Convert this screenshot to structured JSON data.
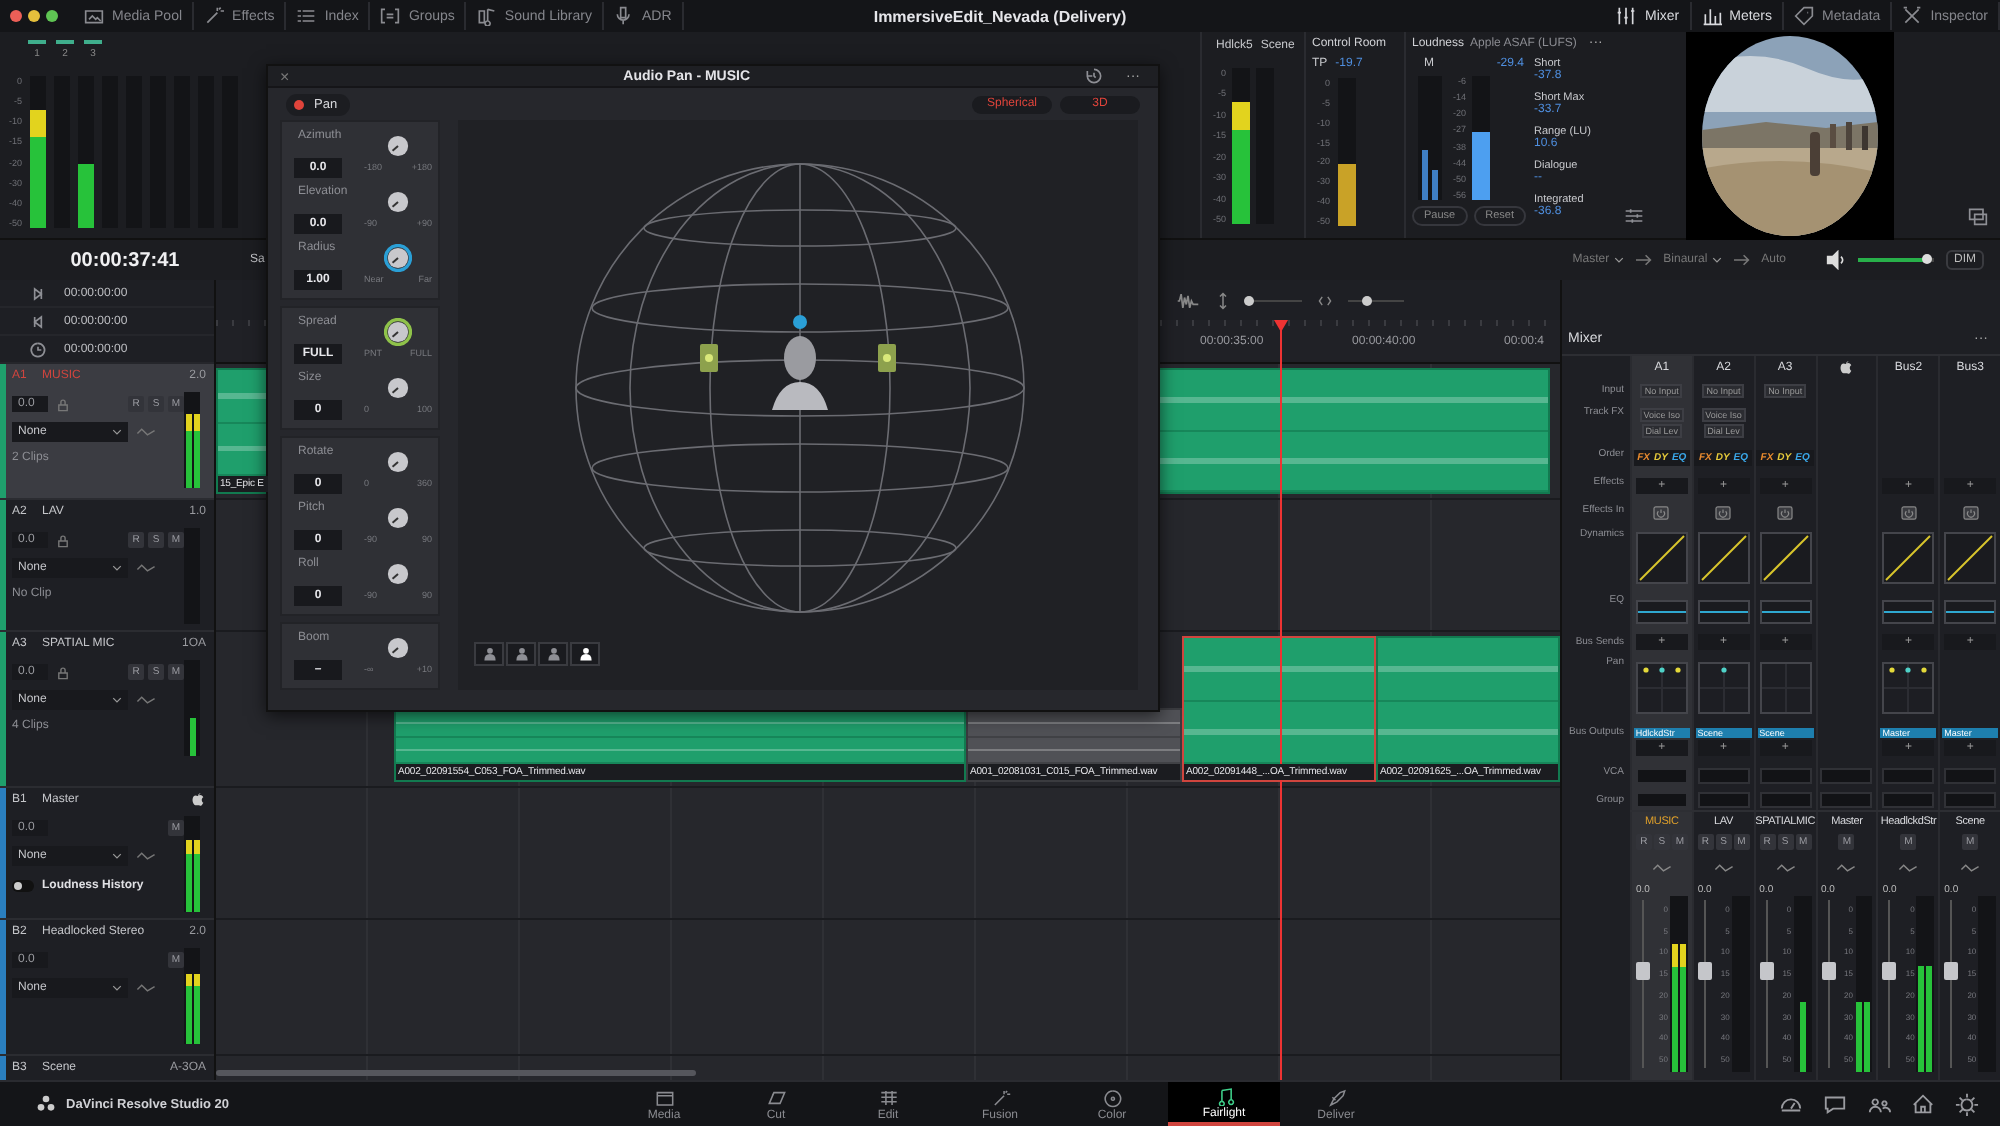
{
  "top_bar": {
    "tabs": [
      {
        "label": "Media Pool"
      },
      {
        "label": "Effects"
      },
      {
        "label": "Index"
      },
      {
        "label": "Groups"
      },
      {
        "label": "Sound Library"
      },
      {
        "label": "ADR"
      }
    ],
    "title": "ImmersiveEdit_Nevada (Delivery)",
    "panels": [
      {
        "label": "Mixer",
        "selected": true
      },
      {
        "label": "Meters",
        "selected": true
      },
      {
        "label": "Metadata",
        "selected": false
      },
      {
        "label": "Inspector",
        "selected": false
      }
    ]
  },
  "meter_panel": {
    "channels": [
      "1",
      "2",
      "3"
    ],
    "scale": [
      "0",
      "-5",
      "-10",
      "-15",
      "-20",
      "-30",
      "-40",
      "-50"
    ],
    "meters": [
      {
        "level": 0.78
      },
      {
        "level": 0
      },
      {
        "level": 0.42
      },
      {
        "level": 0
      },
      {
        "level": 0
      },
      {
        "level": 0
      },
      {
        "level": 0
      },
      {
        "level": 0
      },
      {
        "level": 0
      }
    ]
  },
  "hdlck": {
    "labels": [
      "Hdlck5",
      "Scene"
    ],
    "scale": [
      "0",
      "-5",
      "-10",
      "-15",
      "-20",
      "-30",
      "-40",
      "-50"
    ],
    "meters": [
      {
        "level": 0.78
      },
      {
        "level": 0
      }
    ]
  },
  "control_room": {
    "title": "Control Room",
    "tp_label": "TP",
    "tp_value": "-19.7",
    "scale": [
      "0",
      "-5",
      "-10",
      "-15",
      "-20",
      "-30",
      "-40",
      "-50"
    ],
    "meter": {
      "level": 0.42,
      "color": "#c9a227"
    }
  },
  "loudness": {
    "title": "Loudness",
    "standard": "Apple ASAF (LUFS)",
    "more": "···",
    "m_label": "M",
    "m_value": "-29.4",
    "scale": [
      "-6",
      "-14",
      "-20",
      "-27",
      "-38",
      "-44",
      "-50",
      "-56"
    ],
    "m_meters": [
      {
        "level": 0.4,
        "color": "#3f7fc4"
      },
      {
        "level": 0.25,
        "color": "#3f7fc4"
      }
    ],
    "right_meter": {
      "level": 0.55,
      "color": "#4d9ff0"
    },
    "stats": [
      {
        "label": "Short",
        "value": "-37.8"
      },
      {
        "label": "Short Max",
        "value": "-33.7"
      },
      {
        "label": "Range (LU)",
        "value": "10.6"
      },
      {
        "label": "Dialogue",
        "value": "--"
      },
      {
        "label": "Integrated",
        "value": "-36.8"
      }
    ],
    "buttons": [
      "Pause",
      "Reset"
    ]
  },
  "transport": {
    "timecode": "00:00:37:41",
    "cut_text": "Sa",
    "marks": [
      "00:00:00:00",
      "00:00:00:00",
      "00:00:00:00"
    ]
  },
  "monitor_route": {
    "source": "Master",
    "format": "Binaural",
    "mode": "Auto",
    "volume": {
      "level": 0.92
    },
    "dim": "DIM"
  },
  "pan_window": {
    "title": "Audio Pan - MUSIC",
    "close": "×",
    "more": "···",
    "pan": {
      "label": "Pan",
      "on": true
    },
    "modes": [
      {
        "label": "Spherical",
        "selected": true
      },
      {
        "label": "3D",
        "selected": true
      }
    ],
    "groups": [
      {
        "knobs": [
          {
            "label": "Azimuth",
            "value": "0.0",
            "min": "-180",
            "max": "+180"
          },
          {
            "label": "Elevation",
            "value": "0.0",
            "min": "-90",
            "max": "+90"
          },
          {
            "label": "Radius",
            "value": "1.00",
            "min": "Near",
            "max": "Far",
            "color": "#2a9fd6"
          }
        ]
      },
      {
        "knobs": [
          {
            "label": "Spread",
            "value": "FULL",
            "min": "PNT",
            "max": "FULL",
            "color": "#8fc24a"
          },
          {
            "label": "Size",
            "value": "0",
            "min": "0",
            "max": "100"
          }
        ]
      },
      {
        "knobs": [
          {
            "label": "Rotate",
            "value": "0",
            "min": "0",
            "max": "360"
          },
          {
            "label": "Pitch",
            "value": "0",
            "min": "-90",
            "max": "90"
          },
          {
            "label": "Roll",
            "value": "0",
            "min": "-90",
            "max": "90"
          }
        ]
      },
      {
        "knobs": [
          {
            "label": "Boom",
            "value": "–",
            "min": "-∞",
            "max": "+10"
          }
        ]
      }
    ],
    "views": [
      {
        "selected": false
      },
      {
        "selected": false
      },
      {
        "selected": false
      },
      {
        "selected": true
      }
    ]
  },
  "tracks": [
    {
      "id": "A1",
      "name": "MUSIC",
      "format": "2.0",
      "color": "#1f9f6c",
      "selected": true,
      "kind": "audio",
      "volume": "0.0",
      "buttons": [
        "R",
        "S",
        "M"
      ],
      "input": "None",
      "info": "2 Clips",
      "meters": [
        {
          "level": 0.78
        },
        {
          "level": 0.78
        }
      ],
      "clips": [
        {
          "label": "15_Epic E",
          "selected": false,
          "muted": false
        },
        {
          "selected": false,
          "muted": false
        }
      ]
    },
    {
      "id": "A2",
      "name": "LAV",
      "format": "1.0",
      "color": "#1f9f6c",
      "selected": false,
      "kind": "audio",
      "volume": "0.0",
      "buttons": [
        "R",
        "S",
        "M"
      ],
      "input": "None",
      "info": "No Clip",
      "meters": [
        {
          "level": 0
        }
      ]
    },
    {
      "id": "A3",
      "name": "SPATIAL MIC",
      "format": "1OA",
      "color": "#1f9f6c",
      "selected": false,
      "kind": "audio",
      "volume": "0.0",
      "buttons": [
        "R",
        "S",
        "M"
      ],
      "input": "None",
      "info": "4 Clips",
      "meters": [
        {
          "level": 0.4
        }
      ],
      "clips": [
        {
          "label": "A002_02091554_C053_FOA_Trimmed.wav",
          "selected": false,
          "muted": false
        },
        {
          "label": "A001_02081031_C015_FOA_Trimmed.wav",
          "selected": false,
          "muted": true
        },
        {
          "label": "A002_02091448_...OA_Trimmed.wav",
          "selected": true,
          "muted": false
        },
        {
          "label": "A002_02091625_...OA_Trimmed.wav",
          "selected": false,
          "muted": false
        }
      ]
    },
    {
      "id": "B1",
      "name": "Master",
      "color": "#2a7fbf",
      "selected": false,
      "kind": "master",
      "volume": "0.0",
      "buttons": [
        "M"
      ],
      "input": "None",
      "toggle": {
        "label": "Loudness History",
        "on": false
      },
      "meters": [
        {
          "level": 0.75
        },
        {
          "level": 0.75
        }
      ]
    },
    {
      "id": "B2",
      "name": "Headlocked Stereo",
      "format": "2.0",
      "color": "#2a7fbf",
      "selected": false,
      "kind": "bus",
      "volume": "0.0",
      "buttons": [
        "M"
      ],
      "input": "None",
      "meters": [
        {
          "level": 0.73
        },
        {
          "level": 0.73
        }
      ]
    },
    {
      "id": "B3",
      "name": "Scene",
      "format": "A-3OA",
      "color": "#2a7fbf",
      "selected": false,
      "kind": "bus"
    }
  ],
  "timeline": {
    "ruler": [
      "00:00:35:00",
      "00:00:40:00",
      "00:00:4"
    ],
    "zoom": [
      {
        "level": 0.05
      },
      {
        "level": 0.35
      }
    ]
  },
  "mixer": {
    "title": "Mixer",
    "more": "···",
    "row_labels": [
      "Input",
      "Track FX",
      "Order",
      "Effects",
      "Effects In",
      "Dynamics",
      "EQ",
      "Bus Sends",
      "Pan",
      "Bus Outputs",
      "VCA",
      "Group"
    ],
    "columns": [
      {
        "label": "A1",
        "kind": "track",
        "selected": true,
        "input": "No Input",
        "fx": [
          "Voice Iso",
          "Dial Lev"
        ],
        "order": [
          "FX",
          "DY",
          "EQ"
        ],
        "effects": "+",
        "sends": "+",
        "pan": {
          "kind": "multi"
        },
        "output": "HdlckdStr",
        "output_add": "+"
      },
      {
        "label": "A2",
        "kind": "track",
        "selected": false,
        "input": "No Input",
        "fx": [
          "Voice Iso",
          "Dial Lev"
        ],
        "order": [
          "FX",
          "DY",
          "EQ"
        ],
        "effects": "+",
        "sends": "+",
        "pan": {
          "kind": "single"
        },
        "output": "Scene",
        "output_add": "+"
      },
      {
        "label": "A3",
        "kind": "track",
        "selected": false,
        "input": "No Input",
        "order": [
          "FX",
          "DY",
          "EQ"
        ],
        "effects": "+",
        "sends": "+",
        "pan": {
          "kind": "empty"
        },
        "output": "Scene",
        "output_add": "+"
      },
      {
        "kind": "apple",
        "selected": false
      },
      {
        "label": "Bus2",
        "kind": "track",
        "selected": false,
        "effects": "+",
        "sends": "+",
        "pan": {
          "kind": "multi"
        },
        "output": "Master",
        "output_add": "+"
      },
      {
        "label": "Bus3",
        "kind": "track",
        "selected": false,
        "effects": "+",
        "sends": "+",
        "output": "Master",
        "output_add": "+"
      }
    ],
    "strips": [
      {
        "name": "MUSIC",
        "selected": true,
        "buttons": [
          "R",
          "S",
          "M"
        ],
        "value": "0.0",
        "scale": [
          "0",
          "5",
          "10",
          "15",
          "20",
          "30",
          "40",
          "50"
        ],
        "meters": [
          {
            "level": 0.73
          },
          {
            "level": 0.73
          }
        ]
      },
      {
        "name": "LAV",
        "selected": false,
        "buttons": [
          "R",
          "S",
          "M"
        ],
        "value": "0.0",
        "scale": [
          "0",
          "5",
          "10",
          "15",
          "20",
          "30",
          "40",
          "50"
        ],
        "meters": [
          {
            "level": 0
          }
        ]
      },
      {
        "name": "SPATIALMIC",
        "selected": false,
        "buttons": [
          "R",
          "S",
          "M"
        ],
        "value": "0.0",
        "scale": [
          "0",
          "5",
          "10",
          "15",
          "20",
          "30",
          "40",
          "50"
        ],
        "meters": [
          {
            "level": 0.4
          }
        ]
      },
      {
        "name": "Master",
        "selected": false,
        "buttons": [
          "M"
        ],
        "value": "0.0",
        "scale": [
          "0",
          "5",
          "10",
          "15",
          "20",
          "30",
          "40",
          "50"
        ],
        "meters": [
          {
            "level": 0.4
          },
          {
            "level": 0.4
          }
        ]
      },
      {
        "name": "HeadlckdStr",
        "selected": false,
        "buttons": [
          "M"
        ],
        "value": "0.0",
        "scale": [
          "0",
          "5",
          "10",
          "15",
          "20",
          "30",
          "40",
          "50"
        ],
        "meters": [
          {
            "level": 0.6
          },
          {
            "level": 0.6
          }
        ]
      },
      {
        "name": "Scene",
        "selected": false,
        "buttons": [
          "M"
        ],
        "value": "0.0",
        "scale": [
          "0",
          "5",
          "10",
          "15",
          "20",
          "30",
          "40",
          "50"
        ],
        "meters": [
          {
            "level": 0
          }
        ]
      }
    ]
  },
  "bottom_bar": {
    "product": "DaVinci Resolve Studio 20",
    "pages": [
      {
        "label": "Media",
        "selected": false
      },
      {
        "label": "Cut",
        "selected": false
      },
      {
        "label": "Edit",
        "selected": false
      },
      {
        "label": "Fusion",
        "selected": false
      },
      {
        "label": "Color",
        "selected": false
      },
      {
        "label": "Fairlight",
        "selected": true
      },
      {
        "label": "Deliver",
        "selected": false
      }
    ]
  }
}
